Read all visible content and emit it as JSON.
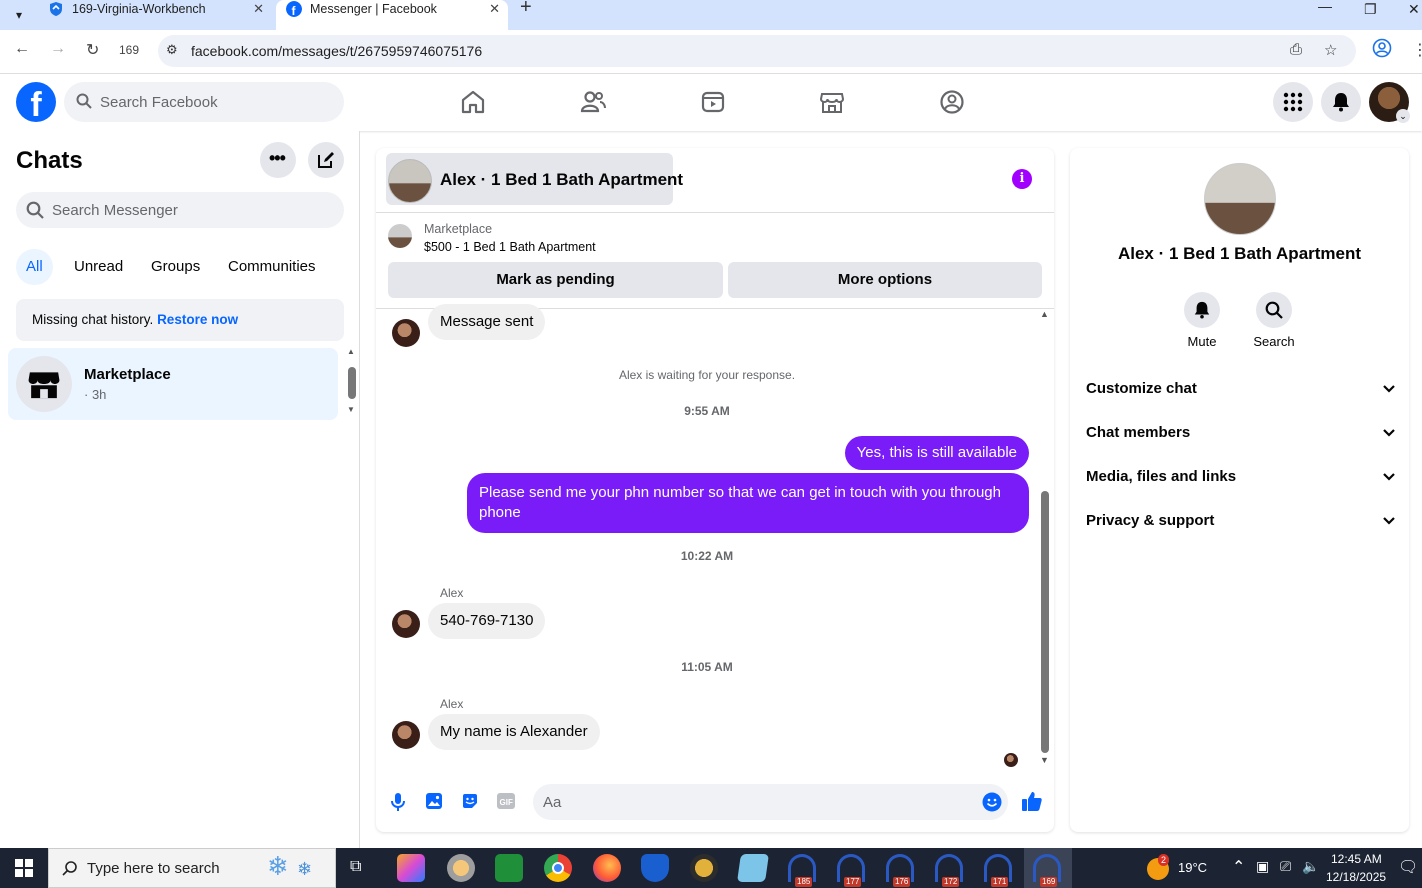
{
  "browser": {
    "tabs": [
      {
        "title": "169-Virginia-Workbench"
      },
      {
        "title": "Messenger | Facebook"
      }
    ],
    "profile_badge": "169",
    "url": "facebook.com/messages/t/2675959746075176"
  },
  "fb_header": {
    "logo": "f",
    "search_placeholder": "Search Facebook"
  },
  "sidebar": {
    "title": "Chats",
    "search_placeholder": "Search Messenger",
    "filters": [
      "All",
      "Unread",
      "Groups",
      "Communities"
    ],
    "missing_text": "Missing chat history.",
    "restore_label": "Restore now",
    "chat": {
      "name": "Marketplace",
      "meta": "· 3h"
    }
  },
  "conversation": {
    "title": "Alex · 1 Bed 1 Bath Apartment",
    "marketplace_label": "Marketplace",
    "listing": "$500 - 1 Bed 1 Bath Apartment",
    "mark_pending": "Mark as pending",
    "more_options": "More options",
    "messages": {
      "m1": "Message sent",
      "waiting": "Alex is waiting for your response.",
      "t1": "9:55 AM",
      "m2": "Yes, this is still available",
      "m3": "Please send me your phn number so that we can get in touch with you through phone",
      "t2": "10:22 AM",
      "s1": "Alex",
      "m4": "540-769-7130",
      "t3": "11:05 AM",
      "s2": "Alex",
      "m5": "My name is Alexander"
    },
    "composer_placeholder": "Aa"
  },
  "details": {
    "name": "Alex · 1 Bed 1 Bath Apartment",
    "mute": "Mute",
    "search": "Search",
    "sections": [
      "Customize chat",
      "Chat members",
      "Media, files and links",
      "Privacy & support"
    ]
  },
  "taskbar": {
    "search_placeholder": "Type here to search",
    "apps": [
      {
        "badge": "185"
      },
      {
        "badge": "177"
      },
      {
        "badge": "176"
      },
      {
        "badge": "172"
      },
      {
        "badge": "171"
      },
      {
        "badge": "169"
      }
    ],
    "weather_badge": "2",
    "temperature": "19°C",
    "time": "12:45 AM",
    "date": "12/18/2025"
  },
  "colors": {
    "fb_blue": "#0866ff",
    "outgoing_bubble": "#7a1cf7",
    "info_purple": "#a100ff"
  }
}
